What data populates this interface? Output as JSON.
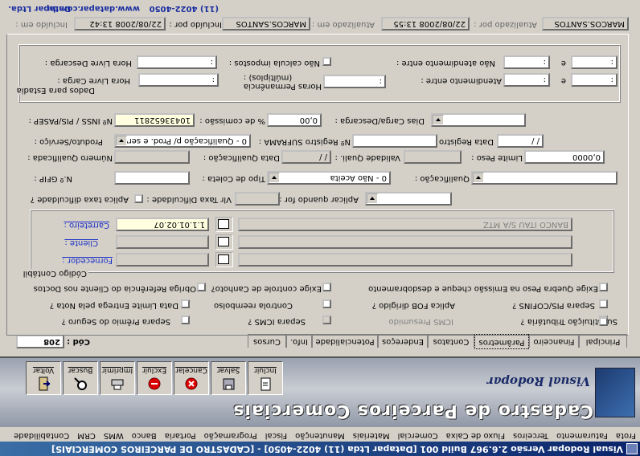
{
  "window": {
    "title": "Visual Rodopar Versão 2.6.967 Build 001 [Datapar Ltda (11) 4022-4050] - [CADASTRO DE PARCEIROS COMERCIAIS]"
  },
  "menu": [
    "Frota",
    "Faturamento",
    "Terceiros",
    "Fluxo de Caixa",
    "Comercial",
    "Materiais",
    "Manutenção",
    "Fiscal",
    "Programação",
    "Portaria",
    "Banco",
    "WMS",
    "CRM",
    "Contabilidade",
    "P"
  ],
  "banner": {
    "app": "Visual Rodopar",
    "title": "Cadastro de Parceiros Comerciais"
  },
  "toolbar": [
    "Incluir",
    "Salvar",
    "Cancelar",
    "Excluir",
    "Imprimir",
    "Buscar",
    "Voltar"
  ],
  "tabs": [
    "Principal",
    "Financeiro",
    "Parâmetros",
    "Contatos",
    "Endereços",
    "Potencialidade",
    "Info.",
    "Cursos"
  ],
  "cod": {
    "label": "Cód :",
    "value": "208"
  },
  "checks": {
    "substituicao": "Substituição Tributária ?",
    "icms_presumido": "ICMS Presumido",
    "separa_icms": "Separa ICMS ?",
    "separa_premio": "Separa Prêmio do Seguro ?",
    "separa_pis": "Separa PIS/COFINS ?",
    "aplica_fob": "Aplica FOB dirigido ?",
    "controla_reembolso": "Controla reembolso",
    "data_limite": "Data Limite Entrega pela Nota ?",
    "obriga_ref": "Obriga Referência do Cliente nos Doctos",
    "exige_canhoto": "Exige controle de Canhoto?",
    "exige_quebra": "Exige Quebra Peso na Emissão cheque e desdobramento"
  },
  "codigo_contabil": {
    "title": "Código Contábil",
    "fornecedor": "Fornecedor :",
    "cliente": "Cliente :",
    "carreteiro": "Carreteiro :",
    "carreteiro_value": "1.1.01.02.07",
    "carreteiro_desc": "BANCO ITAU S/A MTZ"
  },
  "form": {
    "aplica_taxa": "Aplica taxa dificuldade ?",
    "vlr_taxa": "Vlr Taxa Dificuldade :",
    "aplicar_quando": "Aplicar quando for :",
    "nr_gfip": "N.º GFIP :",
    "tipo_coleta": "Tipo de Coleta :",
    "tipo_coleta_value": "0 - Não Aceita",
    "qualificacao": "Qualificação :",
    "numero_qualificada": "Número Qualificada :",
    "data_qualificacao": "Data Qualificação :",
    "data_qualificacao_value": "  /  /",
    "validade_quali": "Validade Quali. :",
    "limite_peso": "Limite Peso :",
    "limite_peso_value": "0,0000",
    "produto_servico": "Produto/Serviço :",
    "produto_servico_value": "0 - Qualificação p/ Prod. e serv",
    "nr_suframa": "Nº Registro SUFRAMA :",
    "data_registro": "Data Registro :",
    "data_registro_value": "/  /",
    "nr_inss": "Nº INSS / PIS/PASEP :",
    "nr_inss_value": "10433652811",
    "pct_comissao": "% de comissão :",
    "pct_comissao_value": "0,00",
    "dias_carga": "Dias Carga/Descarga :"
  },
  "dados_estadia": {
    "title": "Dados para Estadia",
    "hora_livre_carga": "Hora Livre Carga :",
    "horas_permanencia": "Horas Permanência\n(múltiplos) :",
    "atendimento_entre": "Atendimento entre :",
    "hora_livre_descarga": "Hora Livre Descarga :",
    "nao_calcula": "Não calcula impostos :",
    "nao_atendimento": "Não atendimento entre :",
    "e": "e",
    "time_empty": ":"
  },
  "info": {
    "incluido_em": "Incluído em :",
    "incluido_em_value": "22/08/2008 13:42",
    "incluido_por": "Incluído por :",
    "incluido_por_value": "MARCOS.SANTOS",
    "atualizado_em": "Atualizado em :",
    "atualizado_em_value": "22/08/2008 13:55",
    "atualizado_por": "Atualizado por :",
    "atualizado_por_value": "MARCOS.SANTOS"
  },
  "footer": {
    "company": "Datapar Ltda.",
    "site": "www.datapar.com.br",
    "phone": "(11) 4022-4050"
  }
}
